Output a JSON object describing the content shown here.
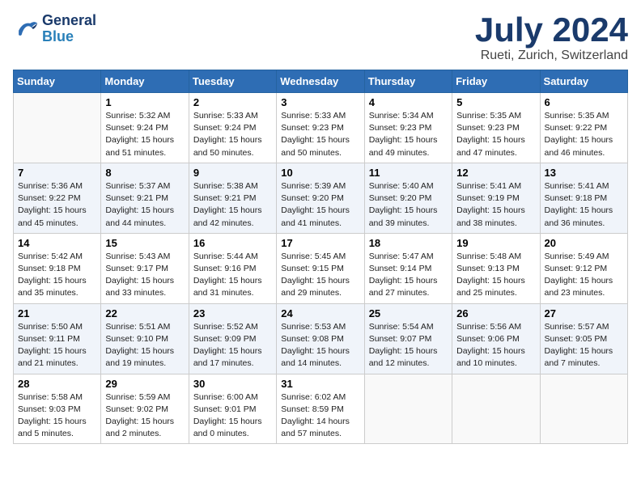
{
  "logo": {
    "line1": "General",
    "line2": "Blue"
  },
  "title": "July 2024",
  "subtitle": "Rueti, Zurich, Switzerland",
  "days_header": [
    "Sunday",
    "Monday",
    "Tuesday",
    "Wednesday",
    "Thursday",
    "Friday",
    "Saturday"
  ],
  "weeks": [
    [
      {
        "day": "",
        "detail": ""
      },
      {
        "day": "1",
        "detail": "Sunrise: 5:32 AM\nSunset: 9:24 PM\nDaylight: 15 hours\nand 51 minutes."
      },
      {
        "day": "2",
        "detail": "Sunrise: 5:33 AM\nSunset: 9:24 PM\nDaylight: 15 hours\nand 50 minutes."
      },
      {
        "day": "3",
        "detail": "Sunrise: 5:33 AM\nSunset: 9:23 PM\nDaylight: 15 hours\nand 50 minutes."
      },
      {
        "day": "4",
        "detail": "Sunrise: 5:34 AM\nSunset: 9:23 PM\nDaylight: 15 hours\nand 49 minutes."
      },
      {
        "day": "5",
        "detail": "Sunrise: 5:35 AM\nSunset: 9:23 PM\nDaylight: 15 hours\nand 47 minutes."
      },
      {
        "day": "6",
        "detail": "Sunrise: 5:35 AM\nSunset: 9:22 PM\nDaylight: 15 hours\nand 46 minutes."
      }
    ],
    [
      {
        "day": "7",
        "detail": "Sunrise: 5:36 AM\nSunset: 9:22 PM\nDaylight: 15 hours\nand 45 minutes."
      },
      {
        "day": "8",
        "detail": "Sunrise: 5:37 AM\nSunset: 9:21 PM\nDaylight: 15 hours\nand 44 minutes."
      },
      {
        "day": "9",
        "detail": "Sunrise: 5:38 AM\nSunset: 9:21 PM\nDaylight: 15 hours\nand 42 minutes."
      },
      {
        "day": "10",
        "detail": "Sunrise: 5:39 AM\nSunset: 9:20 PM\nDaylight: 15 hours\nand 41 minutes."
      },
      {
        "day": "11",
        "detail": "Sunrise: 5:40 AM\nSunset: 9:20 PM\nDaylight: 15 hours\nand 39 minutes."
      },
      {
        "day": "12",
        "detail": "Sunrise: 5:41 AM\nSunset: 9:19 PM\nDaylight: 15 hours\nand 38 minutes."
      },
      {
        "day": "13",
        "detail": "Sunrise: 5:41 AM\nSunset: 9:18 PM\nDaylight: 15 hours\nand 36 minutes."
      }
    ],
    [
      {
        "day": "14",
        "detail": "Sunrise: 5:42 AM\nSunset: 9:18 PM\nDaylight: 15 hours\nand 35 minutes."
      },
      {
        "day": "15",
        "detail": "Sunrise: 5:43 AM\nSunset: 9:17 PM\nDaylight: 15 hours\nand 33 minutes."
      },
      {
        "day": "16",
        "detail": "Sunrise: 5:44 AM\nSunset: 9:16 PM\nDaylight: 15 hours\nand 31 minutes."
      },
      {
        "day": "17",
        "detail": "Sunrise: 5:45 AM\nSunset: 9:15 PM\nDaylight: 15 hours\nand 29 minutes."
      },
      {
        "day": "18",
        "detail": "Sunrise: 5:47 AM\nSunset: 9:14 PM\nDaylight: 15 hours\nand 27 minutes."
      },
      {
        "day": "19",
        "detail": "Sunrise: 5:48 AM\nSunset: 9:13 PM\nDaylight: 15 hours\nand 25 minutes."
      },
      {
        "day": "20",
        "detail": "Sunrise: 5:49 AM\nSunset: 9:12 PM\nDaylight: 15 hours\nand 23 minutes."
      }
    ],
    [
      {
        "day": "21",
        "detail": "Sunrise: 5:50 AM\nSunset: 9:11 PM\nDaylight: 15 hours\nand 21 minutes."
      },
      {
        "day": "22",
        "detail": "Sunrise: 5:51 AM\nSunset: 9:10 PM\nDaylight: 15 hours\nand 19 minutes."
      },
      {
        "day": "23",
        "detail": "Sunrise: 5:52 AM\nSunset: 9:09 PM\nDaylight: 15 hours\nand 17 minutes."
      },
      {
        "day": "24",
        "detail": "Sunrise: 5:53 AM\nSunset: 9:08 PM\nDaylight: 15 hours\nand 14 minutes."
      },
      {
        "day": "25",
        "detail": "Sunrise: 5:54 AM\nSunset: 9:07 PM\nDaylight: 15 hours\nand 12 minutes."
      },
      {
        "day": "26",
        "detail": "Sunrise: 5:56 AM\nSunset: 9:06 PM\nDaylight: 15 hours\nand 10 minutes."
      },
      {
        "day": "27",
        "detail": "Sunrise: 5:57 AM\nSunset: 9:05 PM\nDaylight: 15 hours\nand 7 minutes."
      }
    ],
    [
      {
        "day": "28",
        "detail": "Sunrise: 5:58 AM\nSunset: 9:03 PM\nDaylight: 15 hours\nand 5 minutes."
      },
      {
        "day": "29",
        "detail": "Sunrise: 5:59 AM\nSunset: 9:02 PM\nDaylight: 15 hours\nand 2 minutes."
      },
      {
        "day": "30",
        "detail": "Sunrise: 6:00 AM\nSunset: 9:01 PM\nDaylight: 15 hours\nand 0 minutes."
      },
      {
        "day": "31",
        "detail": "Sunrise: 6:02 AM\nSunset: 8:59 PM\nDaylight: 14 hours\nand 57 minutes."
      },
      {
        "day": "",
        "detail": ""
      },
      {
        "day": "",
        "detail": ""
      },
      {
        "day": "",
        "detail": ""
      }
    ]
  ]
}
